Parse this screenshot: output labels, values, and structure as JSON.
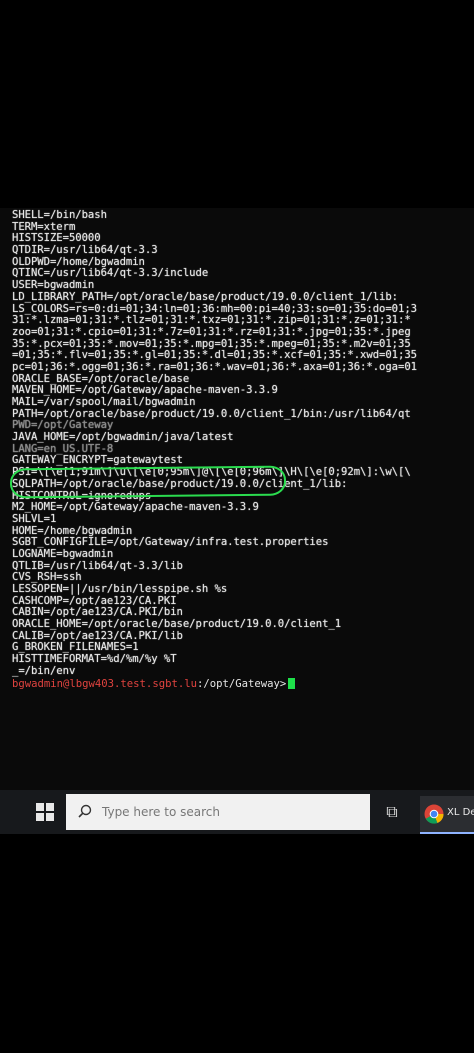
{
  "terminal": {
    "lines": [
      "SHELL=/bin/bash",
      "TERM=xterm",
      "HISTSIZE=50000",
      "QTDIR=/usr/lib64/qt-3.3",
      "OLDPWD=/home/bgwadmin",
      "QTINC=/usr/lib64/qt-3.3/include",
      "USER=bgwadmin",
      "LD_LIBRARY_PATH=/opt/oracle/base/product/19.0.0/client_1/lib:",
      "LS_COLORS=rs=0:di=01;34:ln=01;36:mh=00:pi=40;33:so=01;35:do=01;3",
      "31:*.lzma=01;31:*.tlz=01;31:*.txz=01;31:*.zip=01;31:*.z=01;31:*",
      "zoo=01;31:*.cpio=01;31:*.7z=01;31:*.rz=01;31:*.jpg=01;35:*.jpeg",
      "35:*.pcx=01;35:*.mov=01;35:*.mpg=01;35:*.mpeg=01;35:*.m2v=01;35",
      "=01;35:*.flv=01;35:*.gl=01;35:*.dl=01;35:*.xcf=01;35:*.xwd=01;35",
      "pc=01;36:*.ogg=01;36:*.ra=01;36:*.wav=01;36:*.axa=01;36:*.oga=01",
      "ORACLE_BASE=/opt/oracle/base",
      "MAVEN_HOME=/opt/Gateway/apache-maven-3.3.9",
      "MAIL=/var/spool/mail/bgwadmin",
      "PATH=/opt/oracle/base/product/19.0.0/client_1/bin:/usr/lib64/qt",
      "PWD=/opt/Gateway",
      "JAVA_HOME=/opt/bgwadmin/java/latest",
      "LANG=en_US.UTF-8",
      "GATEWAY_ENCRYPT=gatewaytest",
      "PS1=\\[\\e[1;91m\\]\\u\\[\\e[0;95m\\]@\\[\\e[0;96m\\]\\H\\[\\e[0;92m\\]:\\w\\[\\",
      "SQLPATH=/opt/oracle/base/product/19.0.0/client_1/lib:",
      "HISTCONTROL=ignoredups",
      "M2_HOME=/opt/Gateway/apache-maven-3.3.9",
      "SHLVL=1",
      "HOME=/home/bgwadmin",
      "SGBT_CONFIGFILE=/opt/Gateway/infra.test.properties",
      "LOGNAME=bgwadmin",
      "QTLIB=/usr/lib64/qt-3.3/lib",
      "CVS_RSH=ssh",
      "LESSOPEN=||/usr/bin/lesspipe.sh %s",
      "CASHCOMP=/opt/ae123/CA.PKI",
      "CABIN=/opt/ae123/CA.PKI/bin",
      "ORACLE_HOME=/opt/oracle/base/product/19.0.0/client_1",
      "CALIB=/opt/ae123/CA.PKI/lib",
      "G_BROKEN_FILENAMES=1",
      "HISTTIMEFORMAT=%d/%m/%y %T",
      "_=/bin/env"
    ],
    "prompt_user_host": "bgwadmin@lbgw403.test.sgbt.lu",
    "prompt_path": ":/opt/Gateway>",
    "cursor_color": "#1ee04a",
    "highlight_color": "#2bdc4f"
  },
  "taskbar": {
    "start_icon": "windows-logo-icon",
    "search_placeholder": "Type here to search",
    "taskview_icon": "task-view-icon",
    "taskview_glyph": "⧉",
    "chrome_label": "XL De",
    "chrome_icon": "chrome-icon"
  }
}
